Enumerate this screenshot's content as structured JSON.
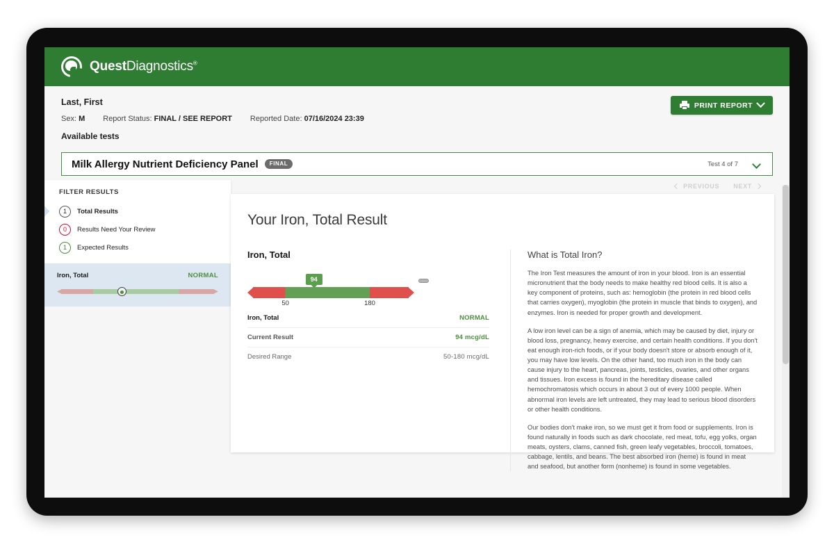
{
  "brand": {
    "name_bold": "Quest",
    "name_light": "Diagnostics",
    "trademark": "®"
  },
  "patient": {
    "name": "Last, First",
    "sex_label": "Sex:",
    "sex_value": "M",
    "status_label": "Report Status:",
    "status_value": "FINAL / SEE REPORT",
    "reported_label": "Reported Date:",
    "reported_value": "07/16/2024 23:39",
    "available_tests_label": "Available tests"
  },
  "toolbar": {
    "print_label": "PRINT REPORT"
  },
  "test_selector": {
    "test_name": "Milk Allergy Nutrient Deficiency Panel",
    "status_badge": "FINAL",
    "counter": "Test 4 of 7"
  },
  "filters": {
    "title": "FILTER RESULTS",
    "items": [
      {
        "count": "1",
        "label": "Total Results",
        "style": "default",
        "active": true
      },
      {
        "count": "0",
        "label": "Results Need Your Review",
        "style": "red",
        "active": false
      },
      {
        "count": "1",
        "label": "Expected Results",
        "style": "green",
        "active": false
      }
    ]
  },
  "rail_result": {
    "name": "Iron, Total",
    "status": "NORMAL"
  },
  "nav": {
    "previous": "PREVIOUS",
    "next": "NEXT"
  },
  "result": {
    "heading": "Your Iron, Total Result",
    "analyte": "Iron, Total",
    "status": "NORMAL",
    "rows": [
      {
        "key": "Current Result",
        "value": "94 mcg/dL",
        "muted": false
      },
      {
        "key": "Desired Range",
        "value": "50-180 mcg/dL",
        "muted": true
      }
    ]
  },
  "chart_data": {
    "type": "bar",
    "title": "Iron, Total reference range gauge",
    "value": 94,
    "value_label": "94",
    "unit": "mcg/dL",
    "range_low": 50,
    "range_high": 180,
    "tick_labels": [
      "50",
      "180"
    ],
    "axis_min": 0,
    "axis_max": 240,
    "status": "NORMAL",
    "zones": [
      {
        "name": "low",
        "from": 0,
        "to": 50,
        "color": "#df4f4b"
      },
      {
        "name": "normal",
        "from": 50,
        "to": 180,
        "color": "#63a055"
      },
      {
        "name": "high",
        "from": 180,
        "to": 240,
        "color": "#df4f4b"
      }
    ],
    "colors": {
      "normal": "#63a055",
      "abnormal": "#df4f4b",
      "marker": "#5b9e4e"
    }
  },
  "info": {
    "heading": "What is Total Iron?",
    "paragraphs": [
      "The Iron Test measures the amount of iron in your blood. Iron is an essential micronutrient that the body needs to make healthy red blood cells. It is also a key component of proteins, such as: hemoglobin (the protein in red blood cells that carries oxygen), myoglobin (the protein in muscle that binds to oxygen), and enzymes. Iron is needed for proper growth and development.",
      "A low iron level can be a sign of anemia, which may be caused by diet, injury or blood loss, pregnancy, heavy exercise, and certain health conditions. If you don't eat enough iron-rich foods, or if your body doesn't store or absorb enough of it, you may have low levels. On the other hand, too much iron in the body can cause injury to the heart, pancreas, joints, testicles, ovaries, and other organs and tissues. Iron excess is found in the hereditary disease called hemochromatosis which occurs in about 3 out of every 1000 people. When abnormal iron levels are left untreated, they may lead to serious blood disorders or other health conditions.",
      "Our bodies don't make iron, so we must get it from food or supplements. Iron is found naturally in foods such as dark chocolate, red meat, tofu, egg yolks, organ meats, oysters, clams, canned fish, green leafy vegetables, broccoli, tomatoes, cabbage, lentils, and beans. The best absorbed iron (heme) is found in meat and seafood, but another form (nonheme) is found in some vegetables."
    ]
  }
}
